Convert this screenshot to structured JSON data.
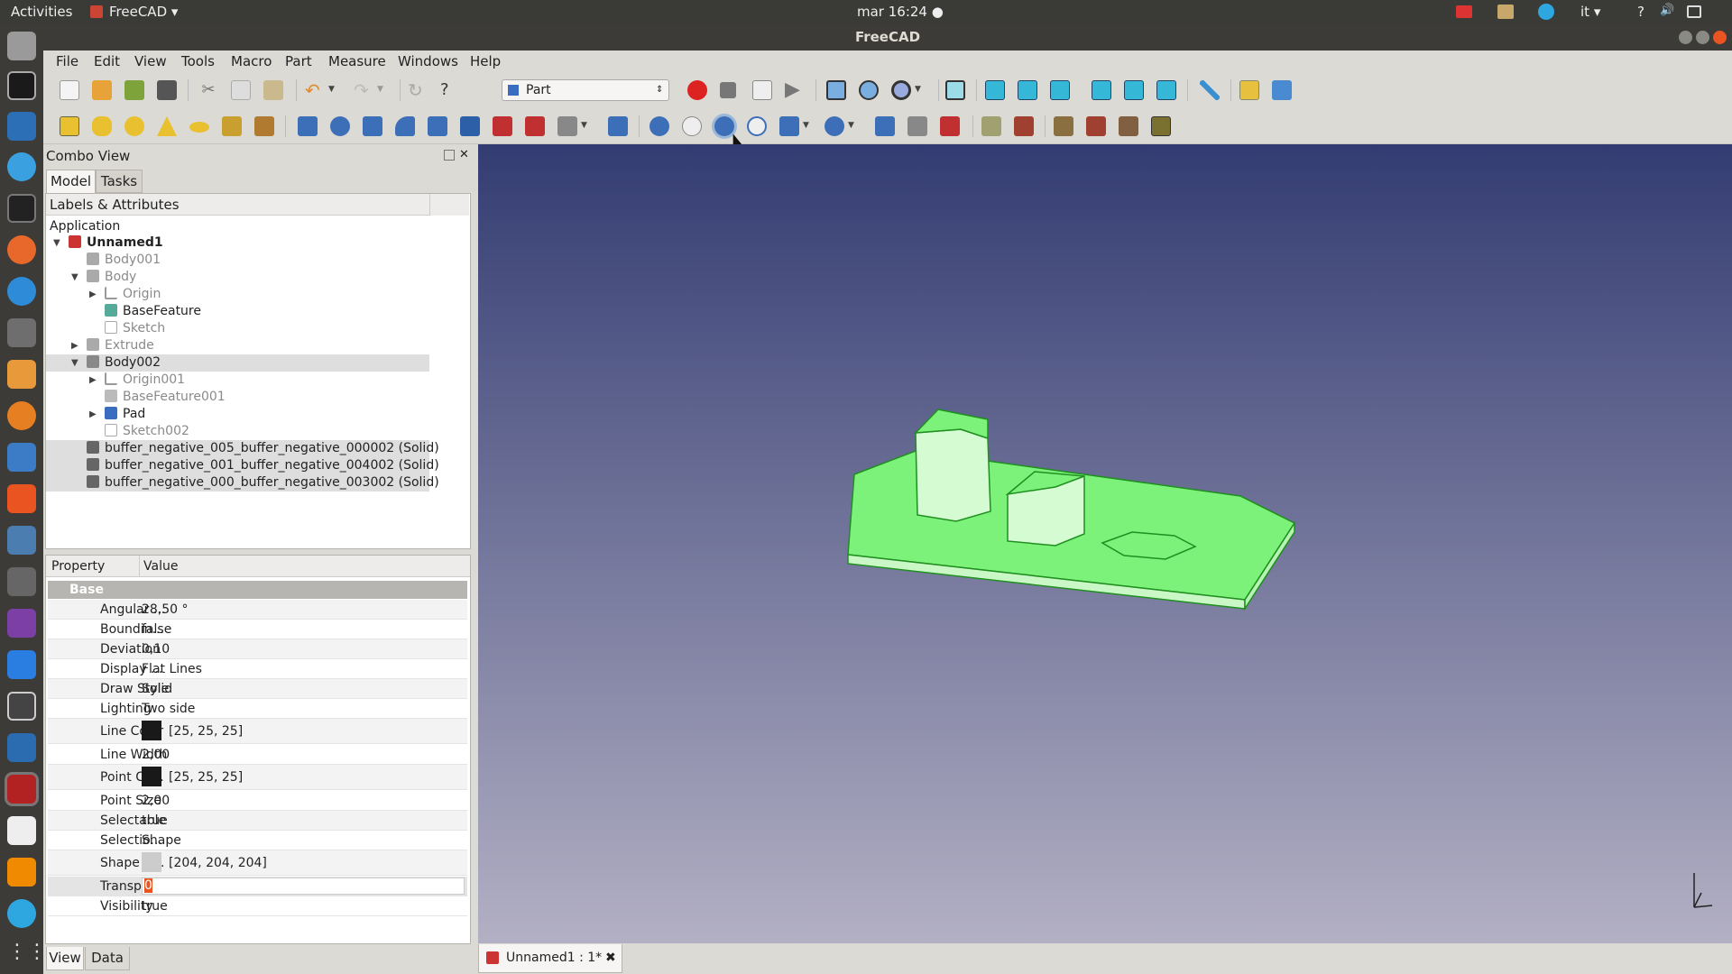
{
  "topbar": {
    "activities": "Activities",
    "app": "FreeCAD ▾",
    "clock": "mar 16:24 ●",
    "lang": "it ▾",
    "help": "?",
    "sound": "🔊"
  },
  "window": {
    "title": "FreeCAD"
  },
  "menu": [
    "File",
    "Edit",
    "View",
    "Tools",
    "Macro",
    "Part",
    "Measure",
    "Windows",
    "Help"
  ],
  "workbench": {
    "selected": "Part"
  },
  "combo": {
    "title": "Combo View",
    "tabs": [
      "Model",
      "Tasks"
    ],
    "tree_header": "Labels & Attributes",
    "application": "Application",
    "items": [
      "Unnamed1",
      "Body001",
      "Body",
      "Origin",
      "BaseFeature",
      "Sketch",
      "Extrude",
      "Body002",
      "Origin001",
      "BaseFeature001",
      "Pad",
      "Sketch002",
      "buffer_negative_005_buffer_negative_000002 (Solid)",
      "buffer_negative_001_buffer_negative_004002 (Solid)",
      "buffer_negative_000_buffer_negative_003002 (Solid)"
    ]
  },
  "props": {
    "header_property": "Property",
    "header_value": "Value",
    "group": "Base",
    "rows": [
      {
        "name": "Angular ...",
        "value": "28,50 °"
      },
      {
        "name": "Boundin...",
        "value": "false"
      },
      {
        "name": "Deviation",
        "value": "0,10"
      },
      {
        "name": "Display ...",
        "value": "Flat Lines"
      },
      {
        "name": "Draw Style",
        "value": "Solid"
      },
      {
        "name": "Lighting",
        "value": "Two side"
      },
      {
        "name": "Line Color",
        "value": "[25, 25, 25]"
      },
      {
        "name": "Line Width",
        "value": "2,00"
      },
      {
        "name": "Point Co...",
        "value": "[25, 25, 25]"
      },
      {
        "name": "Point Size",
        "value": "2,00"
      },
      {
        "name": "Selectable",
        "value": "true"
      },
      {
        "name": "Selectio...",
        "value": "Shape"
      },
      {
        "name": "Shape C...",
        "value": "[204, 204, 204]"
      },
      {
        "name": "Transpar...",
        "value": "0"
      },
      {
        "name": "Visibility",
        "value": "true"
      }
    ],
    "bottom_tabs": [
      "View",
      "Data"
    ]
  },
  "document_tab": "Unnamed1 : 1*",
  "colors": {
    "model": "#7cf27a",
    "edge": "#2aa82a",
    "line_swatch": "#191919",
    "shape_swatch": "#cccccc"
  }
}
